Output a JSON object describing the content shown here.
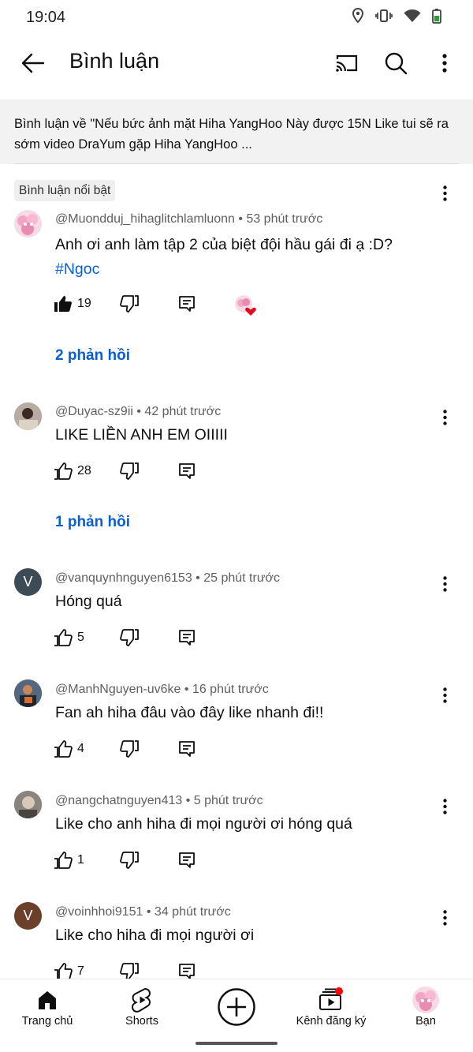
{
  "status": {
    "time": "19:04"
  },
  "header": {
    "title": "Bình luận"
  },
  "video_context": {
    "text": "Bình luận về \"Nếu bức ảnh mặt Hiha YangHoo Này được 15N Like tui sẽ ra sớm video DraYum gặp Hiha YangHoo ..."
  },
  "pinned_label": "Bình luận nổi bật",
  "comments": [
    {
      "meta": "@Muondduj_hihaglitchlamluonn • 53 phút trước",
      "text": "Anh ơi anh làm tập 2 của biệt đội hầu gái đi ạ :D?",
      "hashtag": "#Ngoc",
      "likes": "19",
      "replies": "2 phản hồi"
    },
    {
      "meta": "@Duyac-sz9ii • 42 phút trước",
      "text": "LIKE LIỀN ANH EM OIIIII",
      "likes": "28",
      "replies": "1 phản hồi"
    },
    {
      "meta": "@vanquynhnguyen6153 • 25 phút trước",
      "text": "Hóng quá",
      "likes": "5",
      "avatar_letter": "V"
    },
    {
      "meta": "@ManhNguyen-uv6ke • 16 phút trước",
      "text": "Fan ah hiha đâu vào đây like nhanh đi!!",
      "likes": "4"
    },
    {
      "meta": "@nangchatnguyen413 • 5 phút trước",
      "text": "Like cho anh hiha đi mọi người ơi hóng quá",
      "likes": "1"
    },
    {
      "meta": "@voinhhoi9151 • 34 phút trước",
      "text": "Like cho hiha đi mọi người ơi",
      "likes": "7",
      "avatar_letter": "V"
    }
  ],
  "bottom_nav": [
    {
      "label": "Trang chủ",
      "icon": "home-icon"
    },
    {
      "label": "Shorts",
      "icon": "shorts-icon"
    },
    {
      "label": "",
      "icon": "create-icon"
    },
    {
      "label": "Kênh đăng ký",
      "icon": "subscriptions-icon"
    },
    {
      "label": "Bạn",
      "icon": "profile-avatar"
    }
  ],
  "colors": {
    "link": "#065fd4",
    "meta_text": "#606060",
    "notification_dot": "#ff0000",
    "avatar_gray_blue": "#3d4b57",
    "avatar_brown": "#6b3f2a"
  }
}
